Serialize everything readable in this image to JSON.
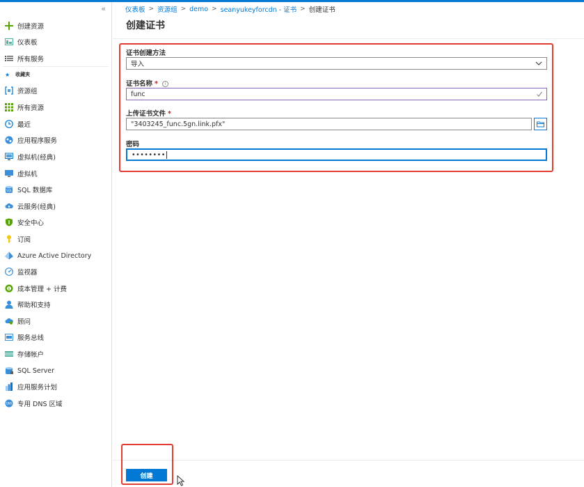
{
  "sidebar": {
    "collapse_glyph": "«",
    "items": [
      {
        "label": "创建资源",
        "icon": "plus-icon"
      },
      {
        "label": "仪表板",
        "icon": "dashboard-icon"
      },
      {
        "label": "所有服务",
        "icon": "list-icon"
      },
      {
        "label": "资源组",
        "icon": "resource-group-icon"
      },
      {
        "label": "所有资源",
        "icon": "grid-icon"
      },
      {
        "label": "最近",
        "icon": "clock-icon"
      },
      {
        "label": "应用程序服务",
        "icon": "app-service-icon"
      },
      {
        "label": "虚拟机(经典)",
        "icon": "vm-classic-icon"
      },
      {
        "label": "虚拟机",
        "icon": "vm-icon"
      },
      {
        "label": "SQL 数据库",
        "icon": "sql-database-icon"
      },
      {
        "label": "云服务(经典)",
        "icon": "cloud-service-icon"
      },
      {
        "label": "安全中心",
        "icon": "shield-icon"
      },
      {
        "label": "订阅",
        "icon": "key-icon"
      },
      {
        "label": "Azure Active Directory",
        "icon": "aad-icon"
      },
      {
        "label": "监视器",
        "icon": "monitor-gauge-icon"
      },
      {
        "label": "成本管理 + 计费",
        "icon": "cost-icon"
      },
      {
        "label": "帮助和支持",
        "icon": "help-person-icon"
      },
      {
        "label": "顾问",
        "icon": "advisor-icon"
      },
      {
        "label": "服务总线",
        "icon": "service-bus-icon"
      },
      {
        "label": "存储帐户",
        "icon": "storage-icon"
      },
      {
        "label": "SQL Server",
        "icon": "sql-server-icon"
      },
      {
        "label": "应用服务计划",
        "icon": "app-plan-icon"
      },
      {
        "label": "专用 DNS 区域",
        "icon": "dns-icon"
      }
    ],
    "favorites_label": "收藏夹"
  },
  "breadcrumb": [
    {
      "label": "仪表板"
    },
    {
      "label": "资源组"
    },
    {
      "label": "demo"
    },
    {
      "label": "seanyukeyforcdn - 证书"
    },
    {
      "label": "创建证书"
    }
  ],
  "breadcrumb_separator": ">",
  "page": {
    "title": "创建证书"
  },
  "form": {
    "method_label": "证书创建方法",
    "method_value": "导入",
    "name_label": "证书名称",
    "name_value": "func",
    "upload_label": "上传证书文件",
    "upload_value": "\"3403245_func.5gn.link.pfx\"",
    "password_label": "密码",
    "password_value": "••••••••",
    "required_mark": "*",
    "info_glyph": "i"
  },
  "actions": {
    "create_label": "创建"
  },
  "colors": {
    "accent": "#0078d4",
    "highlight": "#e03c31",
    "valid_border": "#8764b8"
  }
}
